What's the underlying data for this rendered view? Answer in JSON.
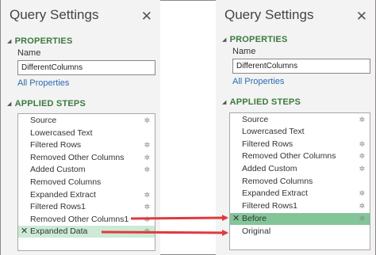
{
  "left": {
    "title": "Query Settings",
    "close_glyph": "✕",
    "properties_header": "PROPERTIES",
    "name_label": "Name",
    "name_value": "DifferentColumns",
    "all_properties": "All Properties",
    "applied_steps_header": "APPLIED STEPS",
    "steps": [
      {
        "label": "Source",
        "gear": true
      },
      {
        "label": "Lowercased Text",
        "gear": false
      },
      {
        "label": "Filtered Rows",
        "gear": true
      },
      {
        "label": "Removed Other Columns",
        "gear": true
      },
      {
        "label": "Added Custom",
        "gear": true
      },
      {
        "label": "Removed Columns",
        "gear": false
      },
      {
        "label": "Expanded Extract",
        "gear": true
      },
      {
        "label": "Filtered Rows1",
        "gear": true
      },
      {
        "label": "Removed Other Columns1",
        "gear": true
      },
      {
        "label": "Expanded Data",
        "gear": true,
        "selected": true
      }
    ]
  },
  "right": {
    "title": "Query Settings",
    "close_glyph": "✕",
    "properties_header": "PROPERTIES",
    "name_label": "Name",
    "name_value": "DifferentColumns",
    "all_properties": "All Properties",
    "applied_steps_header": "APPLIED STEPS",
    "steps": [
      {
        "label": "Source",
        "gear": true
      },
      {
        "label": "Lowercased Text",
        "gear": false
      },
      {
        "label": "Filtered Rows",
        "gear": true
      },
      {
        "label": "Removed Other Columns",
        "gear": true
      },
      {
        "label": "Added Custom",
        "gear": true
      },
      {
        "label": "Removed Columns",
        "gear": false
      },
      {
        "label": "Expanded Extract",
        "gear": true
      },
      {
        "label": "Filtered Rows1",
        "gear": true
      },
      {
        "label": "Before",
        "gear": true,
        "selected": true
      },
      {
        "label": "Original",
        "gear": false
      }
    ]
  },
  "colors": {
    "section_header": "#3c7a3e",
    "link": "#2b6cb0",
    "selected_light": "#ccead6",
    "selected_dark": "#83c598",
    "arrow": "#e03a3e"
  },
  "icons": {
    "close": "close-icon",
    "gear": "gear-icon",
    "delete_step": "x-icon",
    "collapse": "triangle-down-icon"
  }
}
